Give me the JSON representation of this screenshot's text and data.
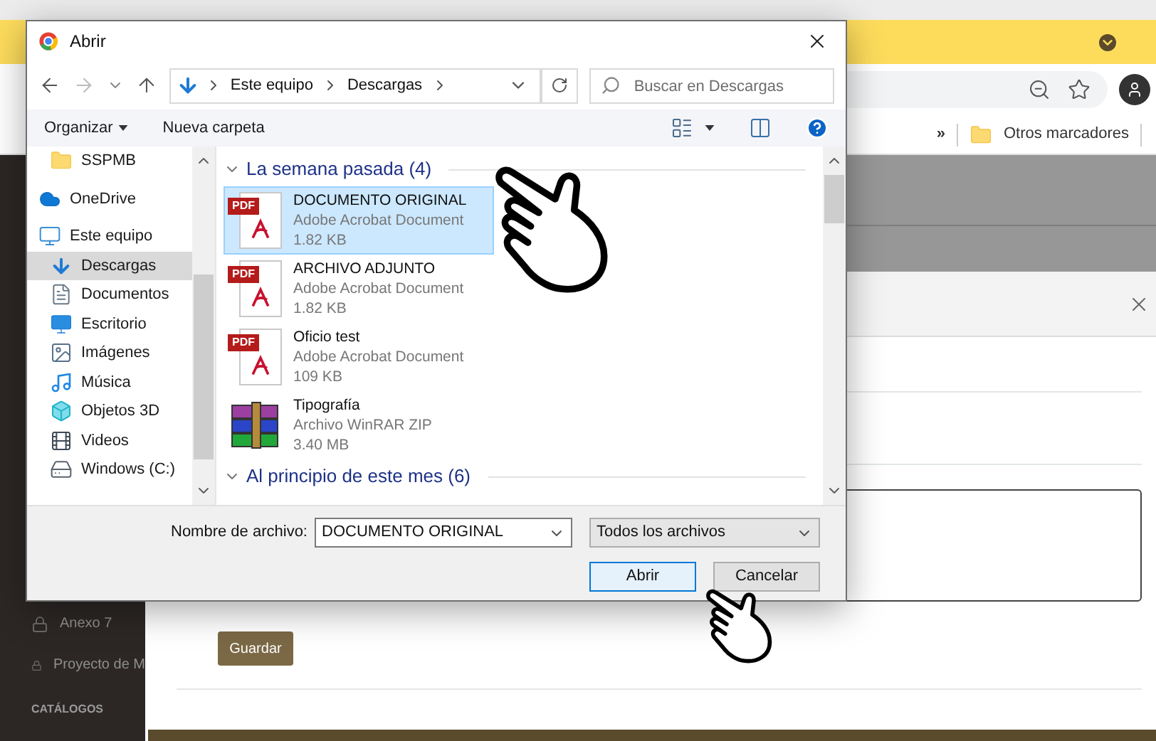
{
  "browser": {
    "bookmarks": {
      "overflow": "»",
      "folder": "Otros marcadores"
    }
  },
  "page": {
    "sidebar": {
      "items": [
        {
          "label": "Anexo 7"
        },
        {
          "label": "Proyecto de M"
        }
      ],
      "section": "CATÁLOGOS"
    },
    "modal": {
      "save_button": "Guardar"
    }
  },
  "dialog": {
    "title": "Abrir",
    "path": [
      "Este equipo",
      "Descargas"
    ],
    "search": {
      "placeholder": "Buscar en Descargas"
    },
    "toolbar": {
      "organize": "Organizar",
      "new_folder": "Nueva carpeta"
    },
    "nav_pane": {
      "items": [
        {
          "children": [
            {
              "label": "SSPMB",
              "selected": false
            }
          ]
        },
        {
          "label": "OneDrive",
          "selected": false
        },
        {
          "label": "Este equipo",
          "selected": false,
          "children": [
            {
              "label": "Descargas",
              "selected": true
            },
            {
              "label": "Documentos",
              "selected": false
            },
            {
              "label": "Escritorio",
              "selected": false
            },
            {
              "label": "Imágenes",
              "selected": false
            },
            {
              "label": "Música",
              "selected": false
            },
            {
              "label": "Objetos 3D",
              "selected": false
            },
            {
              "label": "Videos",
              "selected": false
            },
            {
              "label": "Windows (C:)",
              "selected": false
            }
          ]
        }
      ]
    },
    "groups": [
      {
        "label": "La semana pasada (4)",
        "expanded": true,
        "files": [
          {
            "kind": "pdf",
            "icon_badge": "PDF",
            "name": "DOCUMENTO ORIGINAL",
            "type": "Adobe Acrobat Document",
            "size": "1.82 KB",
            "selected": true
          },
          {
            "kind": "pdf",
            "icon_badge": "PDF",
            "name": "ARCHIVO ADJUNTO",
            "type": "Adobe Acrobat Document",
            "size": "1.82 KB",
            "selected": false
          },
          {
            "kind": "pdf",
            "icon_badge": "PDF",
            "name": "Oficio test",
            "type": "Adobe Acrobat Document",
            "size": "109 KB",
            "selected": false
          },
          {
            "kind": "zip",
            "name": "Tipografía",
            "type": "Archivo WinRAR ZIP",
            "size": "3.40 MB",
            "selected": false
          }
        ]
      },
      {
        "label": "Al principio de este mes (6)",
        "expanded": true
      }
    ],
    "file_name": {
      "label": "Nombre de archivo:",
      "value": "DOCUMENTO ORIGINAL"
    },
    "file_type": {
      "value": "Todos los archivos"
    },
    "buttons": [
      {
        "label": "Abrir",
        "default": true
      },
      {
        "label": "Cancelar",
        "default": false
      }
    ]
  }
}
